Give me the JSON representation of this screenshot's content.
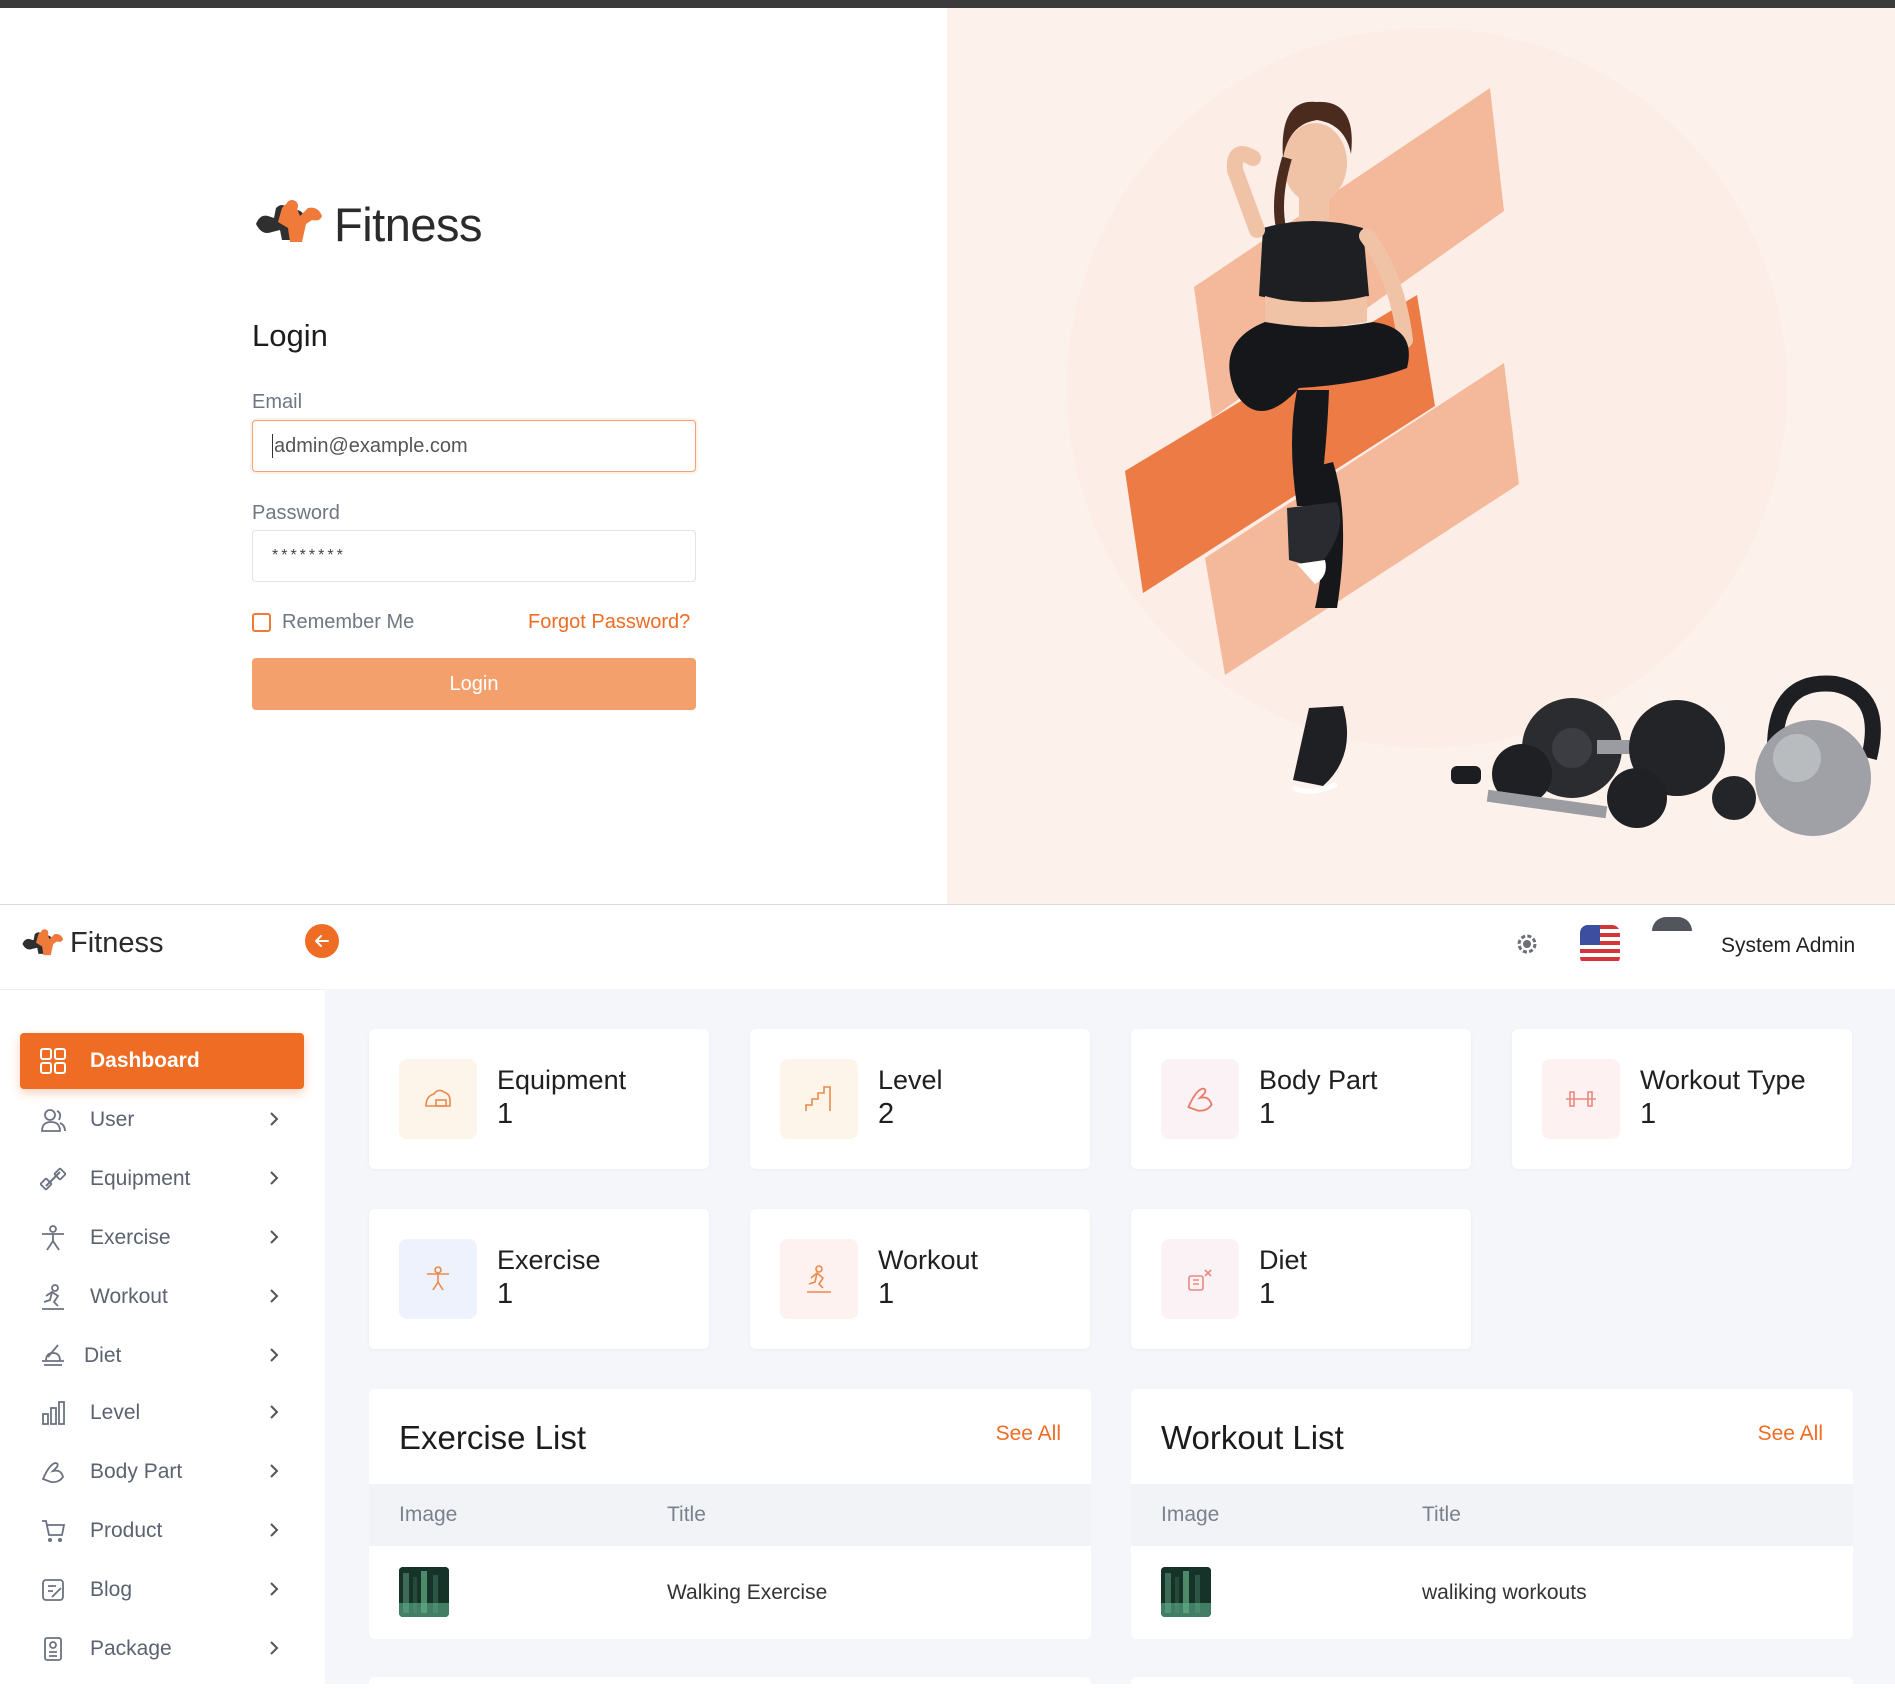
{
  "login": {
    "brand": "Fitness",
    "title": "Login",
    "email_label": "Email",
    "email_value": "admin@example.com",
    "password_label": "Password",
    "password_value": "********",
    "remember_label": "Remember Me",
    "forgot_label": "Forgot Password?",
    "submit_label": "Login"
  },
  "colors": {
    "accent": "#ef6c24",
    "accent_soft": "#f4a06c",
    "hero_bg": "#fdf1ec",
    "dashboard_bg": "#f5f6f9"
  },
  "dashboard": {
    "brand": "Fitness",
    "user_name": "System Admin",
    "sidebar": [
      {
        "label": "Dashboard",
        "icon": "grid-icon"
      },
      {
        "label": "User",
        "icon": "users-icon"
      },
      {
        "label": "Equipment",
        "icon": "dumbbell-icon"
      },
      {
        "label": "Exercise",
        "icon": "person-stretch-icon"
      },
      {
        "label": "Workout",
        "icon": "running-icon"
      },
      {
        "label": "Diet",
        "icon": "diet-icon"
      },
      {
        "label": "Level",
        "icon": "bar-levels-icon"
      },
      {
        "label": "Body Part",
        "icon": "arm-icon"
      },
      {
        "label": "Product",
        "icon": "cart-icon"
      },
      {
        "label": "Blog",
        "icon": "blog-icon"
      },
      {
        "label": "Package",
        "icon": "package-icon"
      }
    ],
    "stats": [
      {
        "title": "Equipment",
        "value": "1",
        "icon": "equipment-icon"
      },
      {
        "title": "Level",
        "value": "2",
        "icon": "level-icon"
      },
      {
        "title": "Body Part",
        "value": "1",
        "icon": "body-part-icon"
      },
      {
        "title": "Workout Type",
        "value": "1",
        "icon": "workout-type-icon"
      },
      {
        "title": "Exercise",
        "value": "1",
        "icon": "exercise-icon"
      },
      {
        "title": "Workout",
        "value": "1",
        "icon": "workout-icon"
      },
      {
        "title": "Diet",
        "value": "1",
        "icon": "diet-icon"
      }
    ],
    "exercise_list": {
      "title": "Exercise List",
      "see_all": "See All",
      "columns": [
        "Image",
        "Title"
      ],
      "rows": [
        {
          "title": "Walking Exercise"
        }
      ]
    },
    "workout_list": {
      "title": "Workout List",
      "see_all": "See All",
      "columns": [
        "Image",
        "Title"
      ],
      "rows": [
        {
          "title": "waliking workouts"
        }
      ]
    }
  }
}
